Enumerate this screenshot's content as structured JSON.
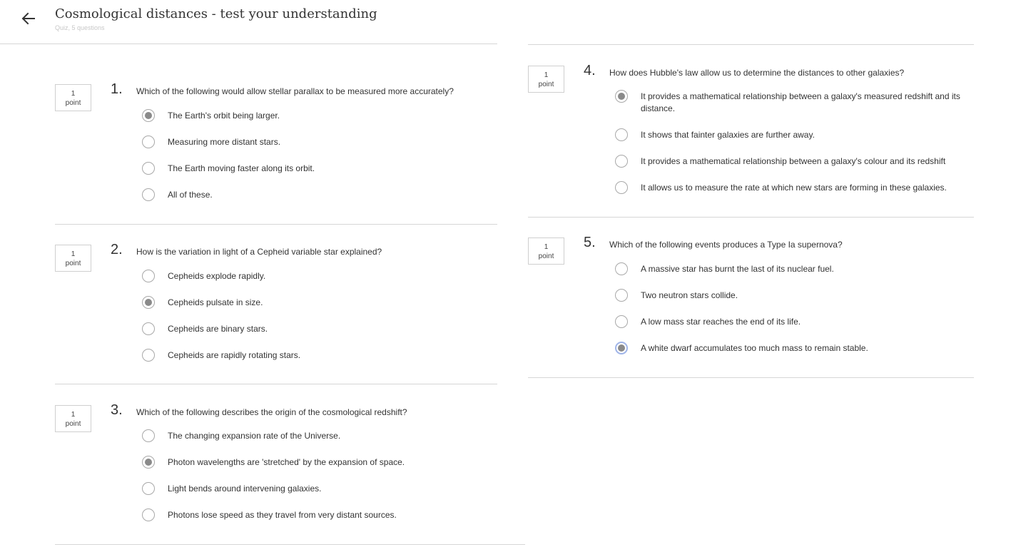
{
  "header": {
    "title": "Cosmological distances - test your understanding",
    "subtitle": "Quiz, 5 questions"
  },
  "icons": {
    "back": "arrow-left-icon"
  },
  "colors": {
    "selected_fill": "#8a8a8a",
    "focus_ring": "#9fb4e8",
    "divider": "#d6d6d6"
  },
  "questions": [
    {
      "number": "1.",
      "points_value": "1",
      "points_unit": "point",
      "text": "Which of the following would allow stellar parallax to be measured more accurately?",
      "options": [
        {
          "label": "The Earth's orbit being larger.",
          "selected": true
        },
        {
          "label": "Measuring more distant stars.",
          "selected": false
        },
        {
          "label": "The Earth moving faster along its orbit.",
          "selected": false
        },
        {
          "label": "All of these.",
          "selected": false
        }
      ]
    },
    {
      "number": "2.",
      "points_value": "1",
      "points_unit": "point",
      "text": "How is the variation in light of a Cepheid variable star explained?",
      "options": [
        {
          "label": "Cepheids explode rapidly.",
          "selected": false
        },
        {
          "label": "Cepheids pulsate in size.",
          "selected": true
        },
        {
          "label": "Cepheids are binary stars.",
          "selected": false
        },
        {
          "label": "Cepheids are rapidly rotating stars.",
          "selected": false
        }
      ]
    },
    {
      "number": "3.",
      "points_value": "1",
      "points_unit": "point",
      "text": "Which of the following describes the origin of the cosmological redshift?",
      "options": [
        {
          "label": "The changing expansion rate of the Universe.",
          "selected": false
        },
        {
          "label": "Photon wavelengths are 'stretched' by the expansion of space.",
          "selected": true
        },
        {
          "label": "Light bends around intervening galaxies.",
          "selected": false
        },
        {
          "label": "Photons lose speed as they travel from very distant sources.",
          "selected": false
        }
      ]
    },
    {
      "number": "4.",
      "points_value": "1",
      "points_unit": "point",
      "text": "How does Hubble's law allow us to determine the distances to other galaxies?",
      "options": [
        {
          "label": "It provides a mathematical relationship between a galaxy's measured redshift and its distance.",
          "selected": true
        },
        {
          "label": "It shows that fainter galaxies are further away.",
          "selected": false
        },
        {
          "label": "It provides a mathematical relationship between a galaxy's colour and its redshift",
          "selected": false
        },
        {
          "label": "It allows us to measure the rate at which new stars are forming in these galaxies.",
          "selected": false
        }
      ]
    },
    {
      "number": "5.",
      "points_value": "1",
      "points_unit": "point",
      "text": "Which of the following events produces a Type Ia supernova?",
      "options": [
        {
          "label": "A massive star has burnt the last of its nuclear fuel.",
          "selected": false
        },
        {
          "label": "Two neutron stars collide.",
          "selected": false
        },
        {
          "label": "A low mass star reaches the end of its life.",
          "selected": false
        },
        {
          "label": "A white dwarf accumulates too much mass to remain stable.",
          "selected": true,
          "focused": true
        }
      ]
    }
  ]
}
